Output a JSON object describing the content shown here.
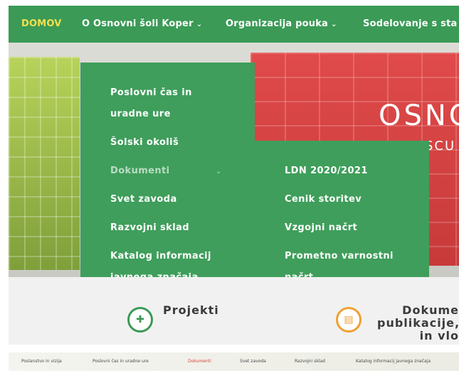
{
  "nav": {
    "items": [
      {
        "label": "DOMOV",
        "active": true,
        "has_chevron": false
      },
      {
        "label": "O Osnovni šoli Koper",
        "active": false,
        "has_chevron": true
      },
      {
        "label": "Organizacija pouka",
        "active": false,
        "has_chevron": true
      },
      {
        "label": "Sodelovanje s sta",
        "active": false,
        "has_chevron": false
      }
    ],
    "chevron": "⌄"
  },
  "hero": {
    "title": "OSNO",
    "subtitle": "SCU"
  },
  "dropdown_primary": {
    "items": [
      {
        "label": "Poslovni čas in"
      },
      {
        "label": "uradne ure"
      },
      {
        "label": "Šolski okoliš"
      },
      {
        "label": "Dokumenti"
      },
      {
        "label": "Svet zavoda"
      },
      {
        "label": "Razvojni sklad"
      },
      {
        "label": "Katalog informacij"
      },
      {
        "label": "javnega značaja"
      }
    ]
  },
  "dropdown_secondary": {
    "items": [
      {
        "label": "LDN 2020/2021"
      },
      {
        "label": "Cenik storitev"
      },
      {
        "label": "Vzgojni načrt"
      },
      {
        "label": "Prometno varnostni"
      },
      {
        "label": "načrt"
      }
    ]
  },
  "cards": [
    {
      "title": "Projekti",
      "icon": "puzzle-icon",
      "color": "#3a9a56"
    },
    {
      "title": "Dokume",
      "title_line2": "publikacije,",
      "title_line3": "in vlo",
      "icon": "document-icon",
      "color": "#f0a030"
    }
  ],
  "footer_links": [
    {
      "label": "Poslanstvo in vizija"
    },
    {
      "label": "Poslovni čas in uradne ure"
    },
    {
      "label": "Dokumenti",
      "current": true
    },
    {
      "label": "Svet zavoda"
    },
    {
      "label": "Razvojni sklad"
    },
    {
      "label": "Katalog informacij javnega značaja"
    }
  ],
  "colors": {
    "nav_bg": "#3a9a56",
    "dropdown_bg": "#3f9e5b",
    "active_nav": "#f4e04d",
    "accent_red": "#d8443a"
  }
}
